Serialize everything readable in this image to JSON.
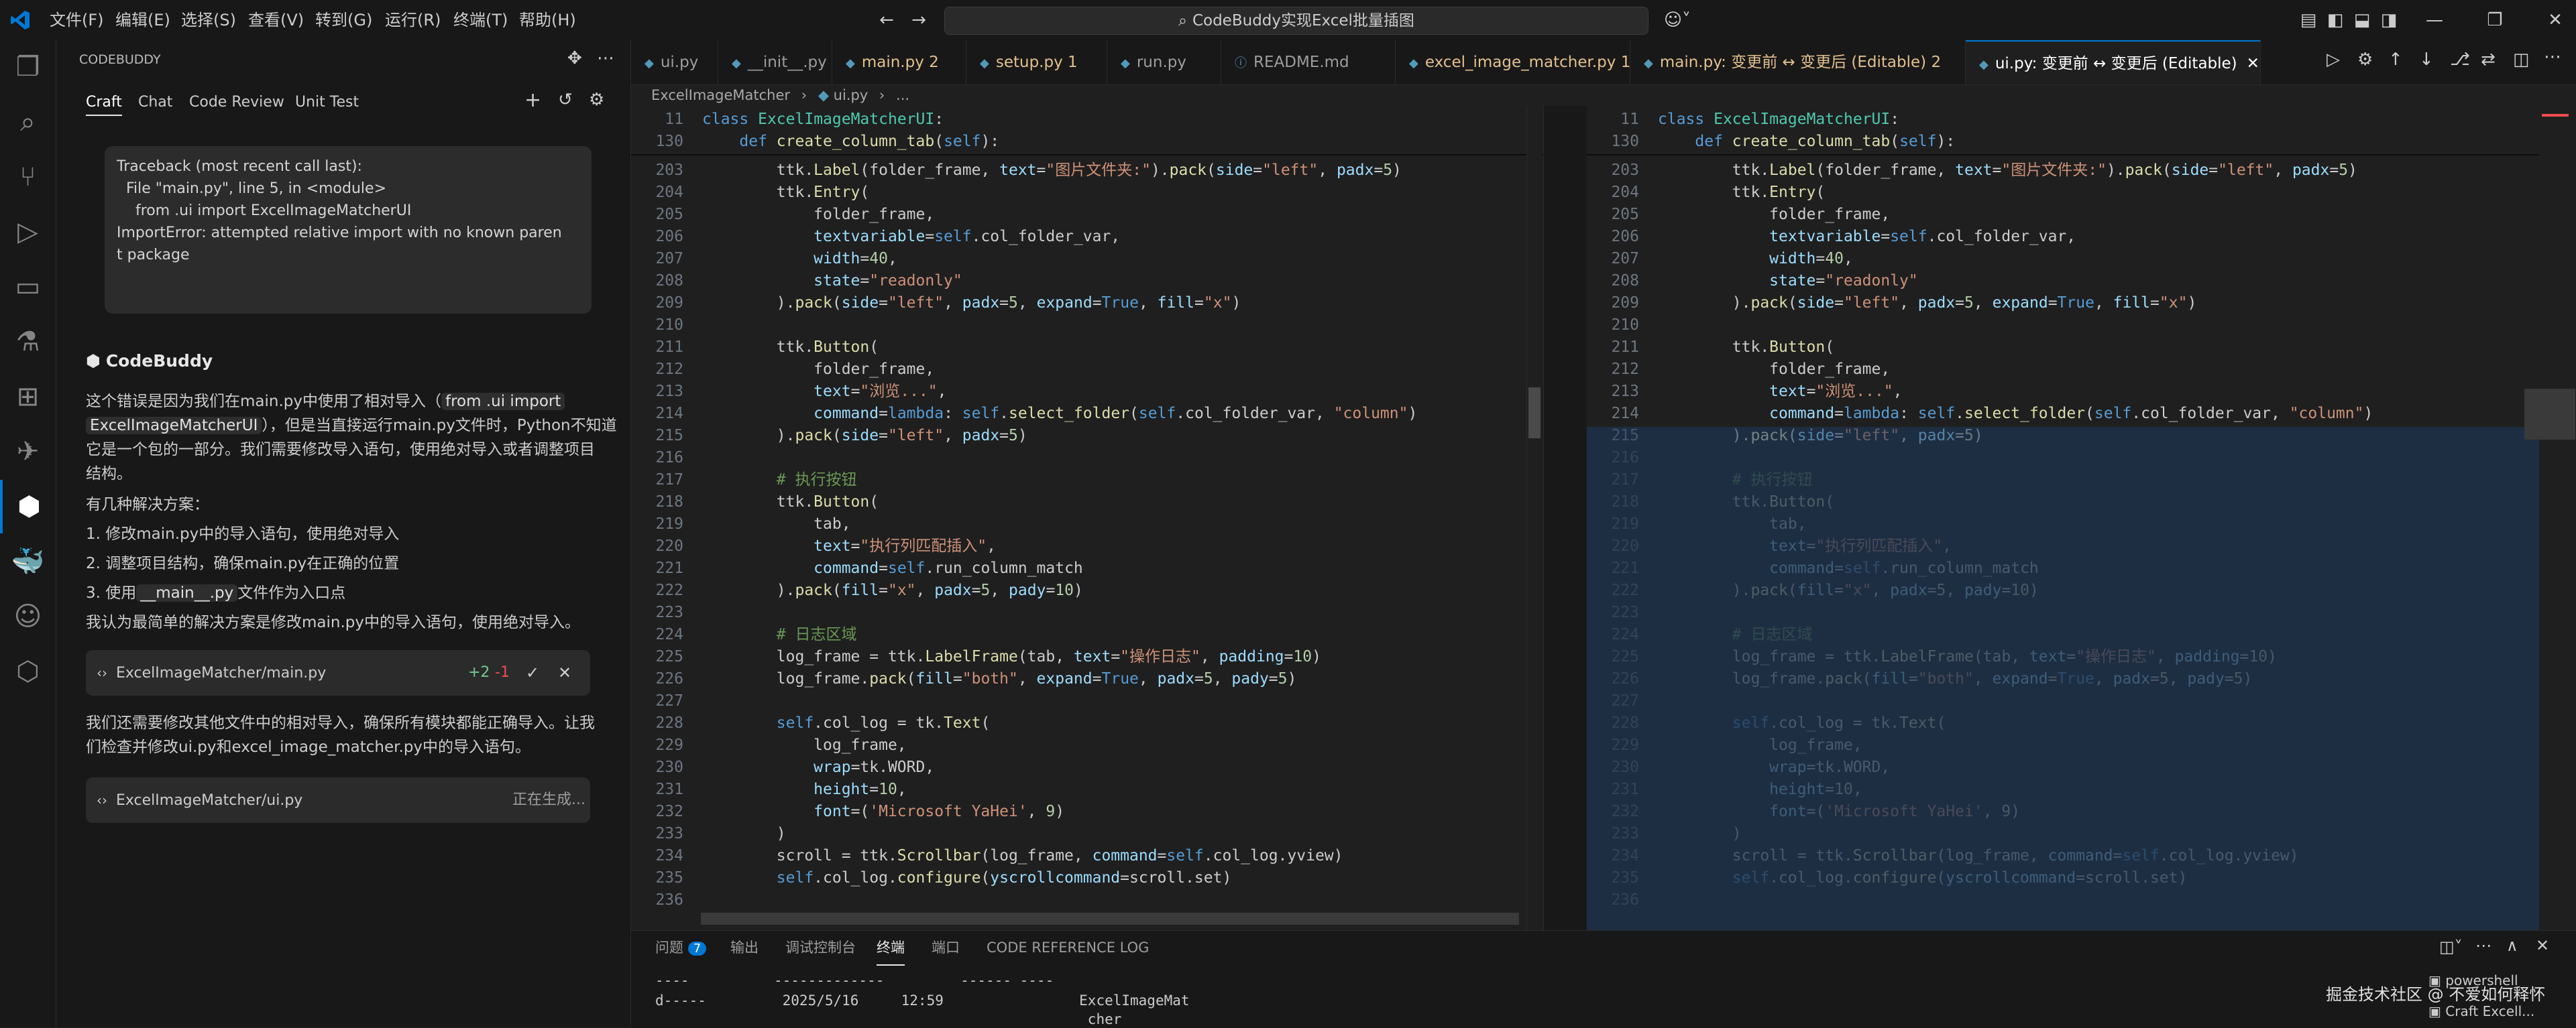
{
  "titlebar": {
    "menus": [
      "文件(F)",
      "编辑(E)",
      "选择(S)",
      "查看(V)",
      "转到(G)",
      "运行(R)",
      "终端(T)",
      "帮助(H)"
    ],
    "search": "CodeBuddy实现Excel批量插图"
  },
  "sidebar": {
    "title": "CODEBUDDY",
    "tabs": [
      "Craft",
      "Chat",
      "Code Review",
      "Unit Test"
    ],
    "error": [
      "Traceback (most recent call last):",
      "  File \"main.py\", line 5, in <module>",
      "    from .ui import ExcelImageMatcherUI",
      "ImportError: attempted relative import with no known paren",
      "t package"
    ],
    "assistant": "CodeBuddy",
    "p1a": "这个错误是因为我们在main.py中使用了相对导入（",
    "p1chip": "from .ui import",
    "p1chip2": "ExcelImageMatcherUI",
    "p1b": "），但是当直接运行main.py文件时，Python不知道",
    "p1c": "它是一个包的一部分。我们需要修改导入语句，使用绝对导入或者调整项目",
    "p1d": "结构。",
    "p2": "有几种解决方案：",
    "s1": "1. 修改main.py中的导入语句，使用绝对导入",
    "s2": "2. 调整项目结构，确保main.py在正确的位置",
    "s3a": "3. 使用",
    "s3chip": "__main__.py",
    "s3b": "文件作为入口点",
    "p3": "我认为最简单的解决方案是修改main.py中的导入语句，使用绝对导入。",
    "card1": {
      "file": "ExcelImageMatcher/main.py",
      "add": "+2",
      "del": "-1"
    },
    "p4": "我们还需要修改其他文件中的相对导入，确保所有模块都能正确导入。让我",
    "p5": "们检查并修改ui.py和excel_image_matcher.py中的导入语句。",
    "card2": {
      "file": "ExcelImageMatcher/ui.py",
      "status": "正在生成..."
    }
  },
  "tabs": [
    {
      "label": "ui.py",
      "badge": ""
    },
    {
      "label": "__init__.py",
      "badge": ""
    },
    {
      "label": "main.py",
      "badge": "2"
    },
    {
      "label": "setup.py",
      "badge": "1"
    },
    {
      "label": "run.py",
      "badge": ""
    },
    {
      "label": "README.md",
      "badge": ""
    },
    {
      "label": "excel_image_matcher.py",
      "badge": "1"
    },
    {
      "label": "main.py: 变更前 ↔ 变更后 (Editable)",
      "badge": "2"
    },
    {
      "label": "ui.py: 变更前 ↔ 变更后 (Editable)",
      "badge": ""
    }
  ],
  "breadcrumb": {
    "folder": "ExcelImageMatcher",
    "file": "ui.py",
    "rest": "..."
  },
  "sticky": [
    {
      "n": "11",
      "text": "class ExcelImageMatcherUI:"
    },
    {
      "n": "130",
      "text": "    def create_column_tab(self):"
    }
  ],
  "code": [
    {
      "n": "203",
      "text": "        ttk.Label(folder_frame, text=\"图片文件夹:\").pack(side=\"left\", padx=5)"
    },
    {
      "n": "204",
      "text": "        ttk.Entry("
    },
    {
      "n": "205",
      "text": "            folder_frame,"
    },
    {
      "n": "206",
      "text": "            textvariable=self.col_folder_var,"
    },
    {
      "n": "207",
      "text": "            width=40,"
    },
    {
      "n": "208",
      "text": "            state=\"readonly\""
    },
    {
      "n": "209",
      "text": "        ).pack(side=\"left\", padx=5, expand=True, fill=\"x\")"
    },
    {
      "n": "210",
      "text": ""
    },
    {
      "n": "211",
      "text": "        ttk.Button("
    },
    {
      "n": "212",
      "text": "            folder_frame,"
    },
    {
      "n": "213",
      "text": "            text=\"浏览...\","
    },
    {
      "n": "214",
      "text": "            command=lambda: self.select_folder(self.col_folder_var, \"column\")"
    },
    {
      "n": "215",
      "text": "        ).pack(side=\"left\", padx=5)"
    },
    {
      "n": "216",
      "text": ""
    },
    {
      "n": "217",
      "text": "        # 执行按钮"
    },
    {
      "n": "218",
      "text": "        ttk.Button("
    },
    {
      "n": "219",
      "text": "            tab,"
    },
    {
      "n": "220",
      "text": "            text=\"执行列匹配插入\","
    },
    {
      "n": "221",
      "text": "            command=self.run_column_match"
    },
    {
      "n": "222",
      "text": "        ).pack(fill=\"x\", padx=5, pady=10)"
    },
    {
      "n": "223",
      "text": ""
    },
    {
      "n": "224",
      "text": "        # 日志区域"
    },
    {
      "n": "225",
      "text": "        log_frame = ttk.LabelFrame(tab, text=\"操作日志\", padding=10)"
    },
    {
      "n": "226",
      "text": "        log_frame.pack(fill=\"both\", expand=True, padx=5, pady=5)"
    },
    {
      "n": "227",
      "text": ""
    },
    {
      "n": "228",
      "text": "        self.col_log = tk.Text("
    },
    {
      "n": "229",
      "text": "            log_frame,"
    },
    {
      "n": "230",
      "text": "            wrap=tk.WORD,"
    },
    {
      "n": "231",
      "text": "            height=10,"
    },
    {
      "n": "232",
      "text": "            font=('Microsoft YaHei', 9)"
    },
    {
      "n": "233",
      "text": "        )"
    },
    {
      "n": "234",
      "text": "        scroll = ttk.Scrollbar(log_frame, command=self.col_log.yview)"
    },
    {
      "n": "235",
      "text": "        self.col_log.configure(yscrollcommand=scroll.set)"
    },
    {
      "n": "236",
      "text": ""
    }
  ],
  "panel": {
    "tabs": [
      "问题",
      "输出",
      "调试控制台",
      "终端",
      "端口",
      "CODE REFERENCE LOG"
    ],
    "problems": "7",
    "terminal": [
      "----          -------------         ------ ----",
      "d-----         2025/5/16     12:59                ExcelImageMat",
      "                                                   cher"
    ],
    "shells": [
      "powershell",
      "Craft Excell..."
    ]
  },
  "watermark": "掘金技术社区 @ 不爱如何释怀",
  "colors": {
    "accent": "#0078d4",
    "bg": "#1f1f1f",
    "sidebar": "#181818",
    "diffAdded": "#1e3a5f"
  }
}
